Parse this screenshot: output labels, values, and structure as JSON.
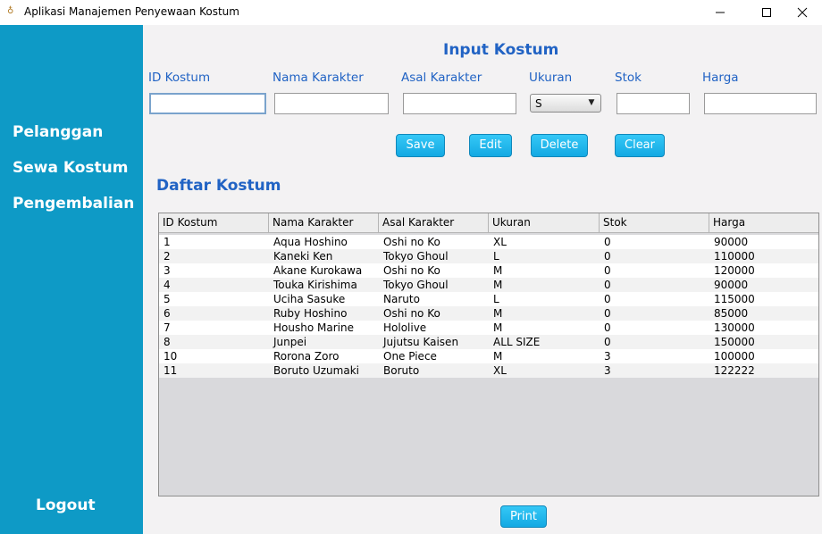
{
  "window": {
    "title": "Aplikasi Manajemen Penyewaan Kostum",
    "app_icon": "costume-app-icon"
  },
  "sidebar": {
    "items": [
      {
        "label": "Pelanggan"
      },
      {
        "label": "Sewa Kostum"
      },
      {
        "label": "Pengembalian"
      }
    ],
    "logout_label": "Logout",
    "background": "#0e9ac6"
  },
  "form": {
    "heading": "Input Kostum",
    "labels": {
      "id": "ID Kostum",
      "nama": "Nama Karakter",
      "asal": "Asal Karakter",
      "ukuran": "Ukuran",
      "stok": "Stok",
      "harga": "Harga"
    },
    "values": {
      "id": "",
      "nama": "",
      "asal": "",
      "ukuran": "S",
      "stok": "",
      "harga": ""
    },
    "buttons": {
      "save": "Save",
      "edit": "Edit",
      "delete": "Delete",
      "clear": "Clear"
    }
  },
  "table": {
    "heading": "Daftar Kostum",
    "columns": [
      "ID Kostum",
      "Nama Karakter",
      "Asal Karakter",
      "Ukuran",
      "Stok",
      "Harga"
    ],
    "rows": [
      [
        "1",
        "Aqua Hoshino",
        "Oshi no Ko",
        "XL",
        "0",
        "90000"
      ],
      [
        "2",
        "Kaneki Ken",
        "Tokyo Ghoul",
        "L",
        "0",
        "110000"
      ],
      [
        "3",
        "Akane Kurokawa",
        "Oshi no Ko",
        "M",
        "0",
        "120000"
      ],
      [
        "4",
        "Touka Kirishima",
        "Tokyo Ghoul",
        "M",
        "0",
        "90000"
      ],
      [
        "5",
        "Uciha Sasuke",
        "Naruto",
        "L",
        "0",
        "115000"
      ],
      [
        "6",
        "Ruby Hoshino",
        "Oshi no Ko",
        "M",
        "0",
        "85000"
      ],
      [
        "7",
        "Housho Marine",
        "Hololive",
        "M",
        "0",
        "130000"
      ],
      [
        "8",
        "Junpei",
        "Jujutsu Kaisen",
        "ALL SIZE",
        "0",
        "150000"
      ],
      [
        "10",
        "Rorona Zoro",
        "One Piece",
        "M",
        "3",
        "100000"
      ],
      [
        "11",
        "Boruto Uzumaki",
        "Boruto",
        "XL",
        "3",
        "122222"
      ]
    ]
  },
  "print_label": "Print",
  "colors": {
    "accent": "#2163c4",
    "button": "#1aaee6"
  }
}
